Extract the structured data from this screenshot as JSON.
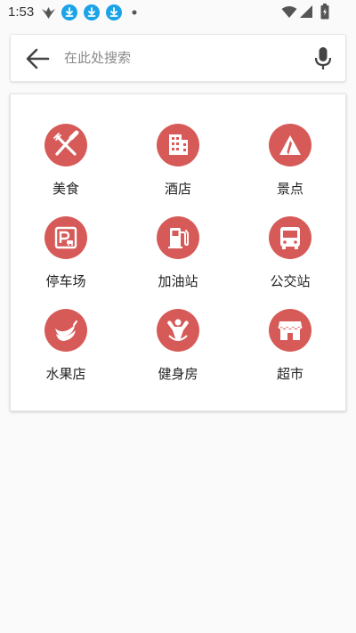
{
  "status_bar": {
    "time": "1:53",
    "icons": [
      "notification-bird-icon",
      "download-icon",
      "download-icon",
      "download-icon",
      "dot-icon",
      "wifi-icon",
      "signal-icon",
      "battery-icon"
    ]
  },
  "search": {
    "placeholder": "在此处搜索",
    "back_icon": "arrow-left-icon",
    "mic_icon": "microphone-icon"
  },
  "categories": [
    {
      "label": "美食",
      "icon": "fork-knife-icon"
    },
    {
      "label": "酒店",
      "icon": "hotel-building-icon"
    },
    {
      "label": "景点",
      "icon": "mountain-icon"
    },
    {
      "label": "停车场",
      "icon": "parking-icon"
    },
    {
      "label": "加油站",
      "icon": "gas-pump-icon"
    },
    {
      "label": "公交站",
      "icon": "bus-icon"
    },
    {
      "label": "水果店",
      "icon": "banana-icon"
    },
    {
      "label": "健身房",
      "icon": "fitness-icon"
    },
    {
      "label": "超市",
      "icon": "store-icon"
    }
  ],
  "colors": {
    "accent": "#d65a58",
    "background": "#fafafa",
    "card": "#ffffff"
  }
}
